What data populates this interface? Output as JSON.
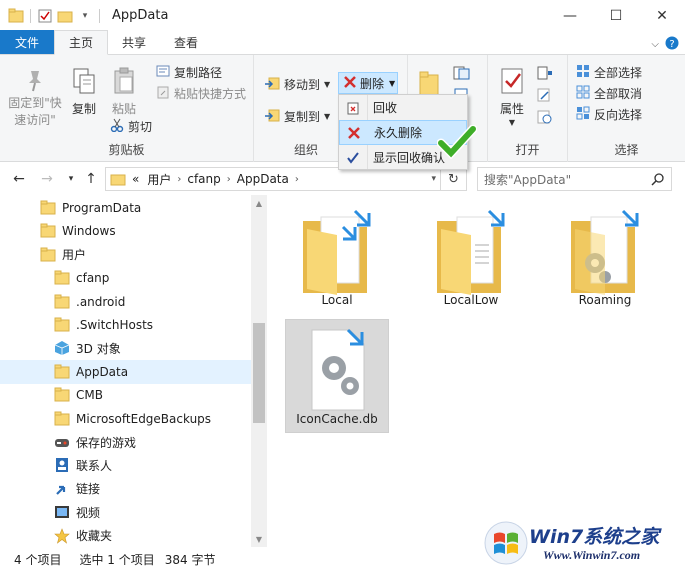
{
  "window": {
    "title": "AppData",
    "controls": {
      "minimize": "—",
      "maximize": "☐",
      "close": "✕"
    }
  },
  "tabs": {
    "file": "文件",
    "home": "主页",
    "share": "共享",
    "view": "查看"
  },
  "ribbon": {
    "clipboard": {
      "group_label": "剪贴板",
      "pin_label": "固定到\"快速访问\"",
      "copy_label": "复制",
      "paste_label": "粘贴",
      "copy_path_label": "复制路径",
      "paste_shortcut_label": "粘贴快捷方式",
      "cut_label": "剪切"
    },
    "organize": {
      "group_label": "组织",
      "move_to_label": "移动到",
      "copy_to_label": "复制到",
      "delete_label": "删除"
    },
    "delete_menu": {
      "recycle": "回收",
      "permanent_delete": "永久删除",
      "show_confirm": "显示回收确认"
    },
    "open": {
      "group_label": "打开",
      "properties_label": "属性"
    },
    "select": {
      "group_label": "选择",
      "select_all": "全部选择",
      "select_none": "全部取消",
      "invert": "反向选择"
    }
  },
  "address": {
    "prefix": "«",
    "crumbs": [
      "用户",
      "cfanp",
      "AppData"
    ],
    "search_placeholder": "搜索\"AppData\""
  },
  "tree": [
    {
      "label": "ProgramData",
      "icon": "folder-icon"
    },
    {
      "label": "Windows",
      "icon": "folder-icon"
    },
    {
      "label": "用户",
      "icon": "folder-icon"
    },
    {
      "label": "cfanp",
      "icon": "folder-icon"
    },
    {
      "label": ".android",
      "icon": "folder-icon"
    },
    {
      "label": ".SwitchHosts",
      "icon": "folder-icon"
    },
    {
      "label": "3D 对象",
      "icon": "3d-objects-icon"
    },
    {
      "label": "AppData",
      "icon": "folder-icon"
    },
    {
      "label": "CMB",
      "icon": "folder-icon"
    },
    {
      "label": "MicrosoftEdgeBackups",
      "icon": "folder-icon"
    },
    {
      "label": "保存的游戏",
      "icon": "saved-games-icon"
    },
    {
      "label": "联系人",
      "icon": "contacts-icon"
    },
    {
      "label": "链接",
      "icon": "links-icon"
    },
    {
      "label": "视频",
      "icon": "videos-icon"
    },
    {
      "label": "收藏夹",
      "icon": "favorites-icon"
    }
  ],
  "files": [
    {
      "name": "Local",
      "type": "folder"
    },
    {
      "name": "LocalLow",
      "type": "folder"
    },
    {
      "name": "Roaming",
      "type": "folder"
    },
    {
      "name": "IconCache.db",
      "type": "file"
    }
  ],
  "status": {
    "item_count": "4 个项目",
    "selection": "选中 1 个项目",
    "size": "384 字节"
  },
  "watermark": {
    "brand": "Win7系统之家",
    "url": "Www.Winwin7.com"
  },
  "colors": {
    "accent": "#1979ca",
    "selection": "#cce8ff",
    "folder": "#f8d775"
  }
}
